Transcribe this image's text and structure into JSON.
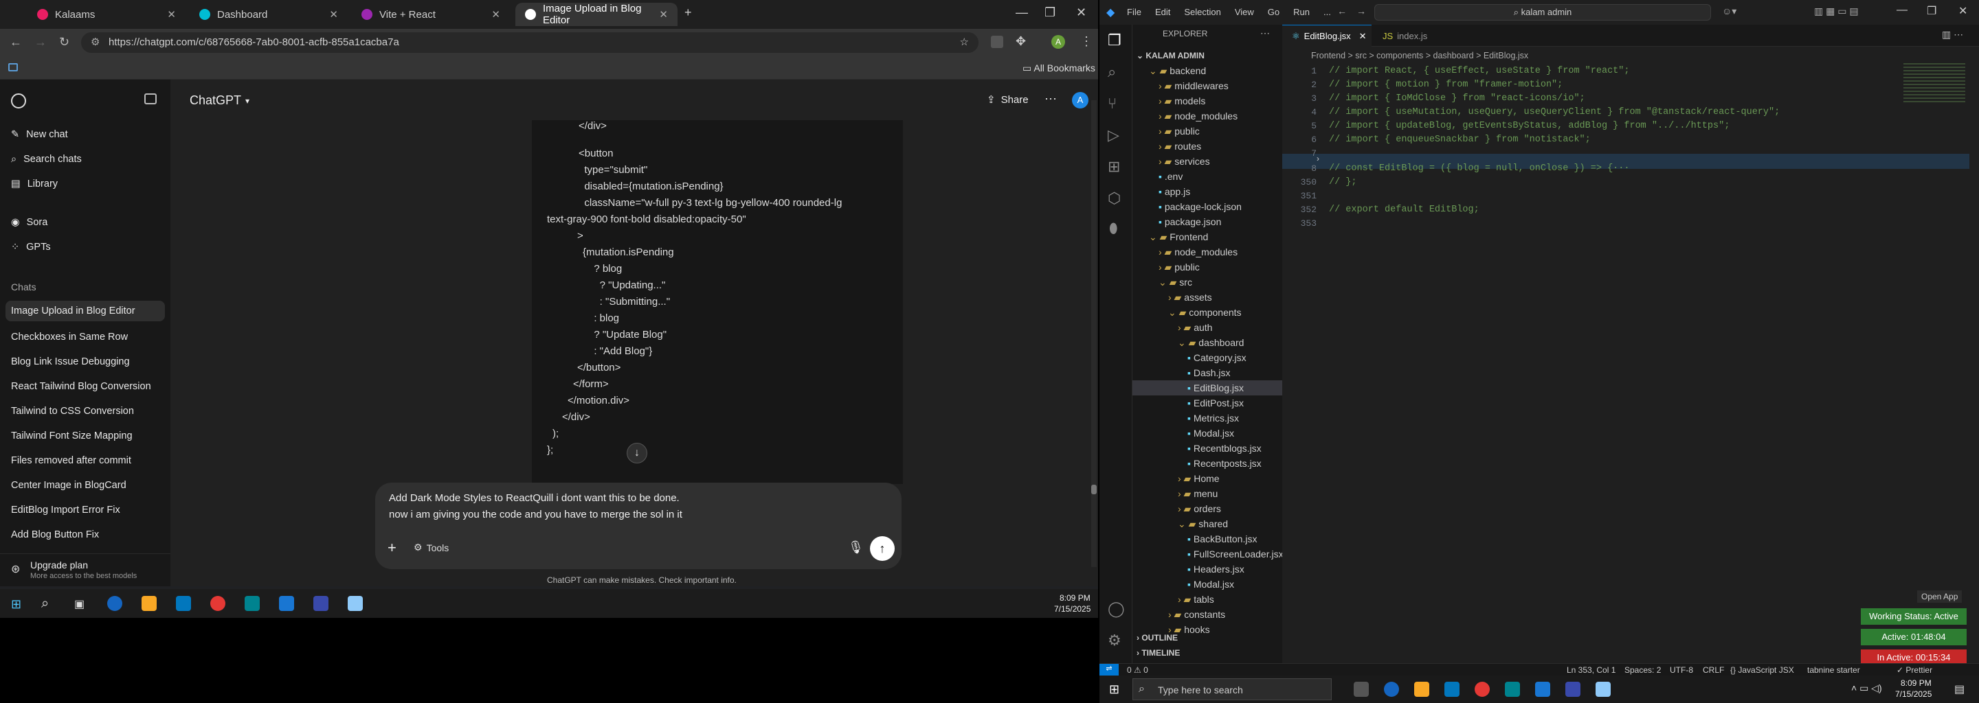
{
  "chrome": {
    "tabs": [
      {
        "title": "Kalaams",
        "active": false
      },
      {
        "title": "Dashboard",
        "active": false
      },
      {
        "title": "Vite + React",
        "active": false
      },
      {
        "title": "Image Upload in Blog Editor",
        "active": true
      }
    ],
    "url": "https://chatgpt.com/c/68765668-7ab0-8001-acfb-855a1cacba7a",
    "bookmarks_label": "All Bookmarks",
    "profile_initial": "A"
  },
  "chatgpt": {
    "model": "ChatGPT",
    "share_label": "Share",
    "avatar_initial": "A",
    "sidebar": {
      "new_chat": "New chat",
      "search": "Search chats",
      "library": "Library",
      "sora": "Sora",
      "gpts": "GPTs",
      "chats_header": "Chats",
      "chats": [
        "Image Upload in Blog Editor",
        "Checkboxes in Same Row",
        "Blog Link Issue Debugging",
        "React Tailwind Blog Conversion",
        "Tailwind to CSS Conversion",
        "Tailwind Font Size Mapping",
        "Files removed after commit",
        "Center Image in BlogCard",
        "EditBlog Import Error Fix",
        "Add Blog Button Fix"
      ],
      "upgrade_title": "Upgrade plan",
      "upgrade_sub": "More access to the best models"
    },
    "code_lines": [
      "</div>",
      "<button",
      "  type=\"submit\"",
      "  disabled={mutation.isPending}",
      "  className=\"w-full py-3 text-lg bg-yellow-400 rounded-lg",
      "text-gray-900 font-bold disabled:opacity-50\"",
      ">",
      "{mutation.isPending",
      "  ? blog",
      "    ? \"Updating...\"",
      "    : \"Submitting...\"",
      "  : blog",
      "  ? \"Update Blog\"",
      "  : \"Add Blog\"}",
      "</button>",
      "</form>",
      "</motion.div>",
      "</div>",
      ");",
      "};"
    ],
    "input_line1": "Add Dark Mode Styles to ReactQuill i dont want this to be done.",
    "input_line2": "now i am giving you the code and you have to merge the sol in it",
    "tools_label": "Tools",
    "disclaimer": "ChatGPT can make mistakes. Check important info."
  },
  "taskbar_left": {
    "time": "8:09 PM",
    "date": "7/15/2025"
  },
  "vscode": {
    "menu": [
      "File",
      "Edit",
      "Selection",
      "View",
      "Go",
      "Run",
      "..."
    ],
    "search_placeholder": "kalam admin",
    "explorer_title": "EXPLORER",
    "root": "KALAM ADMIN",
    "tree": [
      {
        "label": "backend",
        "depth": 1,
        "type": "folder-open"
      },
      {
        "label": "middlewares",
        "depth": 2,
        "type": "folder"
      },
      {
        "label": "models",
        "depth": 2,
        "type": "folder"
      },
      {
        "label": "node_modules",
        "depth": 2,
        "type": "folder"
      },
      {
        "label": "public",
        "depth": 2,
        "type": "folder"
      },
      {
        "label": "routes",
        "depth": 2,
        "type": "folder"
      },
      {
        "label": "services",
        "depth": 2,
        "type": "folder"
      },
      {
        "label": ".env",
        "depth": 2,
        "type": "file"
      },
      {
        "label": "app.js",
        "depth": 2,
        "type": "file"
      },
      {
        "label": "package-lock.json",
        "depth": 2,
        "type": "file"
      },
      {
        "label": "package.json",
        "depth": 2,
        "type": "file"
      },
      {
        "label": "Frontend",
        "depth": 1,
        "type": "folder-open"
      },
      {
        "label": "node_modules",
        "depth": 2,
        "type": "folder"
      },
      {
        "label": "public",
        "depth": 2,
        "type": "folder"
      },
      {
        "label": "src",
        "depth": 2,
        "type": "folder-open"
      },
      {
        "label": "assets",
        "depth": 3,
        "type": "folder"
      },
      {
        "label": "components",
        "depth": 3,
        "type": "folder-open"
      },
      {
        "label": "auth",
        "depth": 4,
        "type": "folder"
      },
      {
        "label": "dashboard",
        "depth": 4,
        "type": "folder-open"
      },
      {
        "label": "Category.jsx",
        "depth": 5,
        "type": "file"
      },
      {
        "label": "Dash.jsx",
        "depth": 5,
        "type": "file"
      },
      {
        "label": "EditBlog.jsx",
        "depth": 5,
        "type": "file",
        "selected": true
      },
      {
        "label": "EditPost.jsx",
        "depth": 5,
        "type": "file"
      },
      {
        "label": "Metrics.jsx",
        "depth": 5,
        "type": "file"
      },
      {
        "label": "Modal.jsx",
        "depth": 5,
        "type": "file"
      },
      {
        "label": "Recentblogs.jsx",
        "depth": 5,
        "type": "file"
      },
      {
        "label": "Recentposts.jsx",
        "depth": 5,
        "type": "file"
      },
      {
        "label": "Home",
        "depth": 4,
        "type": "folder"
      },
      {
        "label": "menu",
        "depth": 4,
        "type": "folder"
      },
      {
        "label": "orders",
        "depth": 4,
        "type": "folder"
      },
      {
        "label": "shared",
        "depth": 4,
        "type": "folder-open"
      },
      {
        "label": "BackButton.jsx",
        "depth": 5,
        "type": "file"
      },
      {
        "label": "FullScreenLoader.jsx",
        "depth": 5,
        "type": "file"
      },
      {
        "label": "Headers.jsx",
        "depth": 5,
        "type": "file"
      },
      {
        "label": "Modal.jsx",
        "depth": 5,
        "type": "file"
      },
      {
        "label": "tabls",
        "depth": 4,
        "type": "folder"
      },
      {
        "label": "constants",
        "depth": 3,
        "type": "folder"
      },
      {
        "label": "hooks",
        "depth": 3,
        "type": "folder"
      }
    ],
    "outline": "OUTLINE",
    "timeline": "TIMELINE",
    "tabs": [
      {
        "title": "EditBlog.jsx",
        "active": true
      },
      {
        "title": "index.js",
        "active": false
      }
    ],
    "breadcrumb": "Frontend > src > components > dashboard > EditBlog.jsx",
    "lines": [
      {
        "n": "1",
        "t": "// import React, { useEffect, useState } from \"react\";"
      },
      {
        "n": "2",
        "t": "// import { motion } from \"framer-motion\";"
      },
      {
        "n": "3",
        "t": "// import { IoMdClose } from \"react-icons/io\";"
      },
      {
        "n": "4",
        "t": "// import { useMutation, useQuery, useQueryClient } from \"@tanstack/react-query\";"
      },
      {
        "n": "5",
        "t": "// import { updateBlog, getEventsByStatus, addBlog } from \"../../https\";"
      },
      {
        "n": "6",
        "t": "// import { enqueueSnackbar } from \"notistack\";"
      },
      {
        "n": "7",
        "t": ""
      },
      {
        "n": "8",
        "t": "// const EditBlog = ({ blog = null, onClose }) => {···"
      },
      {
        "n": "350",
        "t": "// };"
      },
      {
        "n": "351",
        "t": ""
      },
      {
        "n": "352",
        "t": "// export default EditBlog;"
      },
      {
        "n": "353",
        "t": ""
      }
    ],
    "open_app": "Open App",
    "badges": [
      {
        "text": "Working Status: Active",
        "color": "#2e7d32"
      },
      {
        "text": "Active: 01:48:04",
        "color": "#2e7d32"
      },
      {
        "text": "In Active: 00:15:34",
        "color": "#c62828"
      }
    ],
    "status": {
      "errors": "0 ⚠ 0",
      "cursor": "Ln 353, Col 1",
      "spaces": "Spaces: 2",
      "encoding": "UTF-8",
      "eol": "CRLF",
      "language": "{} JavaScript JSX",
      "tabnine": "tabnine starter",
      "prettier": "✓ Prettier"
    }
  },
  "windows": {
    "search_placeholder": "Type here to search",
    "time": "8:09 PM",
    "date": "7/15/2025"
  }
}
